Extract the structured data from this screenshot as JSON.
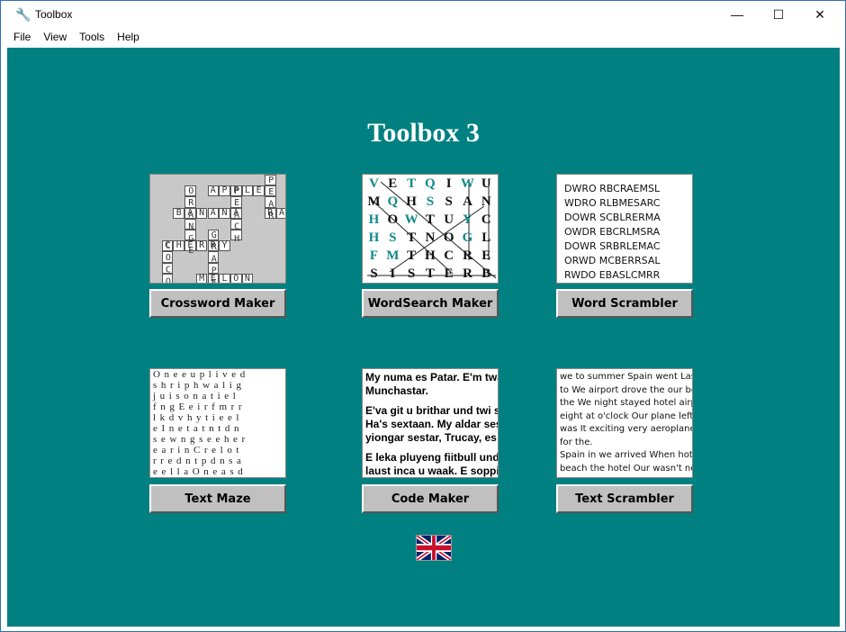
{
  "window": {
    "title": "Toolbox",
    "minimize": "—",
    "maximize": "☐",
    "close": "✕"
  },
  "menu": [
    "File",
    "View",
    "Tools",
    "Help"
  ],
  "app_title": "Toolbox 3",
  "tools": [
    {
      "label": "Crossword Maker"
    },
    {
      "label": "WordSearch Maker"
    },
    {
      "label": "Word Scrambler"
    },
    {
      "label": "Text Maze"
    },
    {
      "label": "Code Maker"
    },
    {
      "label": "Text Scrambler"
    }
  ],
  "crossword": {
    "words": [
      {
        "w": "PEAR",
        "r": 0,
        "c": 10,
        "d": "v"
      },
      {
        "w": "APPLE",
        "r": 1,
        "c": 5,
        "d": "h"
      },
      {
        "w": "ORANGE",
        "r": 1,
        "c": 3,
        "d": "v"
      },
      {
        "w": "PEACH",
        "r": 1,
        "c": 7,
        "d": "v"
      },
      {
        "w": "BANANA",
        "r": 3,
        "c": 2,
        "d": "h"
      },
      {
        "w": "RAI",
        "r": 3,
        "c": 10,
        "d": "h"
      },
      {
        "w": "GRAPE",
        "r": 5,
        "c": 5,
        "d": "v"
      },
      {
        "w": "CHERRY",
        "r": 6,
        "c": 1,
        "d": "h"
      },
      {
        "w": "COCO",
        "r": 6,
        "c": 1,
        "d": "v"
      },
      {
        "w": "MELON",
        "r": 9,
        "c": 4,
        "d": "h"
      }
    ]
  },
  "wordsearch": {
    "rows": [
      "VETQIWU",
      "MQHSSAN",
      "HOWTUYC",
      "HSTNOGL",
      "FMTHCRE",
      "SISTERB"
    ],
    "teal_mask": [
      "1011010",
      "0101000",
      "1010010",
      "1100010",
      "1100000",
      "0000000"
    ],
    "teal": "#108888"
  },
  "word_scrambler": [
    "DWRO RBCRAEMSL",
    "WDRO RLBMESARC",
    "DOWR SCBLRERMA",
    "OWDR EBCRLMSRA",
    "DOWR SRBRLEMAC",
    "ORWD MCBERRSAL",
    "RWDO EBASLCMRR"
  ],
  "text_maze": [
    "Oneeuplived",
    "shriphwalig",
    "juisonatiel",
    "fngEeirfmrr",
    "lkdvhytieel",
    "eInetatntdn",
    "sewngseeher",
    "earinCrelot",
    "rredntpdnsa",
    "eellaOneasd"
  ],
  "code_maker": [
    [
      "My numa es Patar. E'm twa",
      "Munchastar."
    ],
    [
      "E'va git u brithar und twi se",
      "Ha's sextaan. My aldar ses",
      "yiongar sestar, Trucay, es"
    ],
    [
      "E leka pluyeng fiitbull und",
      "laust inca u waak. E soppir"
    ]
  ],
  "text_scrambler": [
    "we to summer Spain went Last",
    "to We airport drove the our be",
    "the We night stayed hotel airp",
    "eight at o'clock Our plane left",
    "was It exciting very aeroplane",
    "for the.",
    "Spain in we arrived When hot v",
    "beach the hotel Our wasn't ne"
  ],
  "language_flag": "united-kingdom-flag",
  "colors": {
    "background": "#008080",
    "button": "#c0c0c0"
  }
}
